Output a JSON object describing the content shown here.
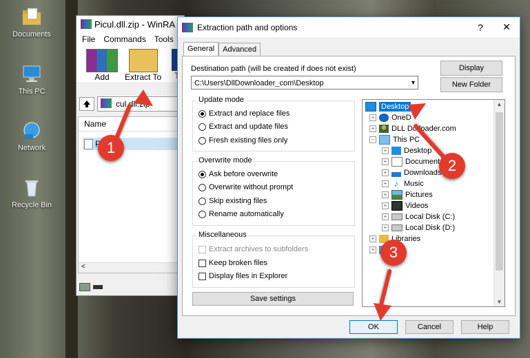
{
  "desktop": {
    "icons": [
      {
        "label": "Documents"
      },
      {
        "label": "This PC"
      },
      {
        "label": "Network"
      },
      {
        "label": "Recycle Bin"
      }
    ]
  },
  "winrar": {
    "title": "Picul.dll.zip - WinRA",
    "menu": [
      "File",
      "Commands",
      "Tools"
    ],
    "toolbar": {
      "add": "Add",
      "extract_to": "Extract To",
      "extra": "T"
    },
    "path_text": "cul.dll.zip",
    "column_name": "Name",
    "selected_file": "Pi          ll",
    "scroll_left": "<"
  },
  "dialog": {
    "title": "Extraction path and options",
    "help_glyph": "?",
    "close_glyph": "✕",
    "tabs": {
      "general": "General",
      "advanced": "Advanced"
    },
    "dest_label": "Destination path (will be created if does not exist)",
    "dest_value": "C:\\Users\\DllDownloader_com\\Desktop",
    "display_button": "Display",
    "new_folder_button": "New Folder",
    "update_mode": {
      "title": "Update mode",
      "options": [
        "Extract and replace files",
        "Extract and update files",
        "Fresh existing files only"
      ],
      "selected": 0
    },
    "overwrite_mode": {
      "title": "Overwrite mode",
      "options": [
        "Ask before overwrite",
        "Overwrite without prompt",
        "Skip existing files",
        "Rename automatically"
      ],
      "selected": 0
    },
    "misc": {
      "title": "Miscellaneous",
      "options": [
        "Extract archives to subfolders",
        "Keep broken files",
        "Display files in Explorer"
      ]
    },
    "save_settings": "Save settings",
    "tree": {
      "items": [
        {
          "label": "Desktop",
          "level": 0,
          "selected": true
        },
        {
          "label": "OneD",
          "level": 1
        },
        {
          "label": "DLL Do      loader.com",
          "level": 1
        },
        {
          "label": "This PC",
          "level": 1
        },
        {
          "label": "Desktop",
          "level": 2
        },
        {
          "label": "Documents",
          "level": 2
        },
        {
          "label": "Downloads",
          "level": 2
        },
        {
          "label": "Music",
          "level": 2
        },
        {
          "label": "Pictures",
          "level": 2
        },
        {
          "label": "Videos",
          "level": 2
        },
        {
          "label": "Local Disk (C:)",
          "level": 2
        },
        {
          "label": "Local Disk (D:)",
          "level": 2
        },
        {
          "label": "Libraries",
          "level": 1
        },
        {
          "label": "    ork",
          "level": 1
        }
      ]
    },
    "ok_button": "OK",
    "cancel_button": "Cancel",
    "help_button": "Help"
  },
  "markers": [
    "1",
    "2",
    "3"
  ],
  "colors": {
    "marker": "#e23b2e",
    "selection": "#cce4f7",
    "tree_selection": "#0078d7"
  }
}
